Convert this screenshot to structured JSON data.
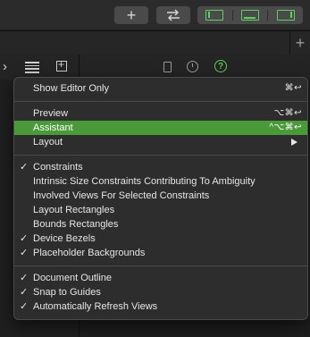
{
  "toolbar": {
    "plus_icon": "plus-icon",
    "swap_icon": "swap-arrows-icon",
    "layout_icons": [
      "left-panel-icon",
      "bottom-panel-icon",
      "right-panel-icon"
    ],
    "accent_color": "#60d060"
  },
  "tabstrip": {
    "add_tab": "+"
  },
  "jumpbar": {
    "chevron": "›",
    "inspector_help": "?"
  },
  "menu": {
    "items": [
      {
        "label": "Show Editor Only",
        "shortcut": "⌘↩",
        "checked": false
      },
      {
        "label": "Preview",
        "shortcut": "⌥⌘↩",
        "checked": false
      },
      {
        "label": "Assistant",
        "shortcut": "^⌥⌘↩",
        "checked": false,
        "highlighted": true
      },
      {
        "label": "Layout",
        "submenu": true,
        "checked": false
      },
      {
        "label": "Constraints",
        "checked": true
      },
      {
        "label": "Intrinsic Size Constraints Contributing To Ambiguity",
        "checked": false
      },
      {
        "label": "Involved Views For Selected Constraints",
        "checked": false
      },
      {
        "label": "Layout Rectangles",
        "checked": false
      },
      {
        "label": "Bounds Rectangles",
        "checked": false
      },
      {
        "label": "Device Bezels",
        "checked": true
      },
      {
        "label": "Placeholder Backgrounds",
        "checked": true
      },
      {
        "label": "Document Outline",
        "checked": true
      },
      {
        "label": "Snap to Guides",
        "checked": true
      },
      {
        "label": "Automatically Refresh Views",
        "checked": true
      }
    ],
    "check_glyph": "✓",
    "highlight_color": "#4a9a3a"
  }
}
